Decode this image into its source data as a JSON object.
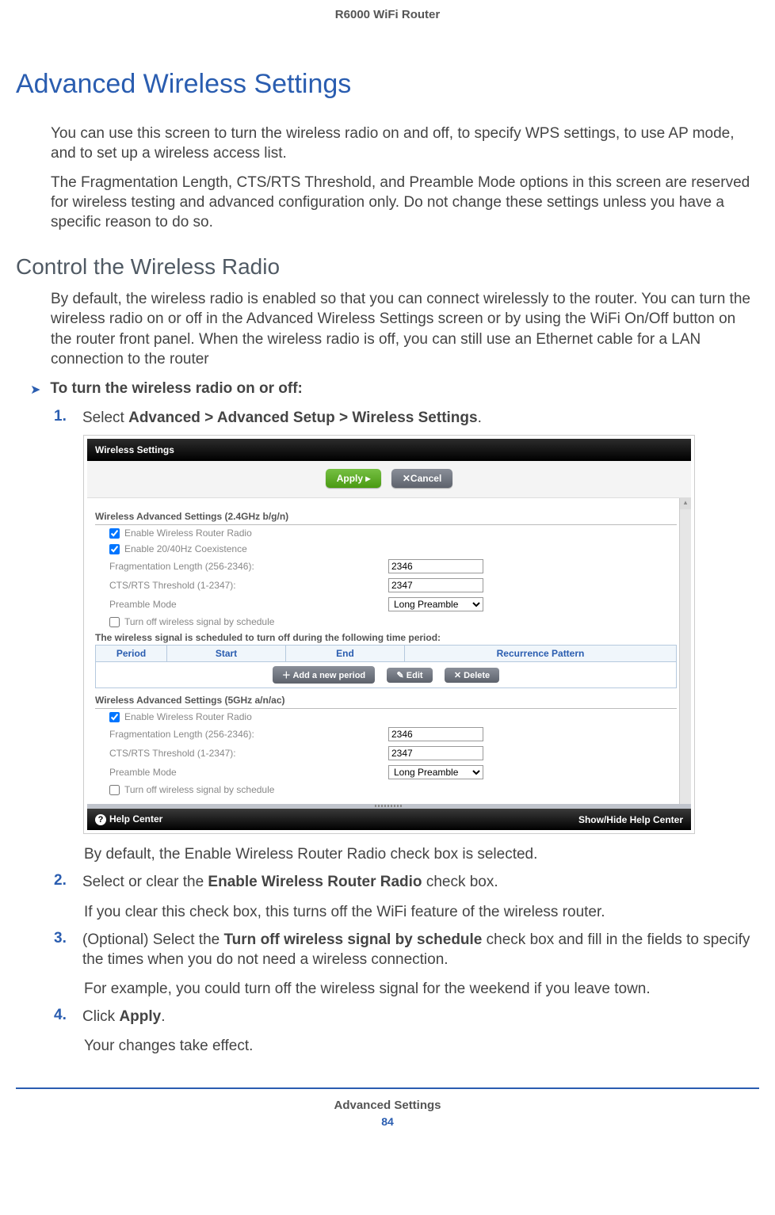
{
  "header": {
    "product": "R6000 WiFi Router"
  },
  "h1": "Advanced Wireless Settings",
  "intro": [
    "You can use this screen to turn the wireless radio on and off, to specify WPS settings, to use AP mode, and to set up a wireless access list.",
    "The Fragmentation Length, CTS/RTS Threshold, and Preamble Mode options in this screen are reserved for wireless testing and advanced configuration only. Do not change these settings unless you have a specific reason to do so."
  ],
  "h2": "Control the Wireless Radio",
  "section_intro": "By default, the wireless radio is enabled so that you can connect wirelessly to the router. You can turn the wireless radio on or off in the Advanced Wireless Settings screen or by using the WiFi On/Off button on the router front panel. When the wireless radio is off, you can still use an Ethernet cable for a LAN connection to the router",
  "procedure": {
    "title": "To turn the wireless radio on or off:",
    "steps": [
      {
        "num": "1.",
        "parts": [
          {
            "text": "Select ",
            "bold": false
          },
          {
            "text": "Advanced > Advanced Setup > Wireless Settings",
            "bold": true
          },
          {
            "text": ".",
            "bold": false
          }
        ],
        "followups": [
          "By default, the Enable Wireless Router Radio check box is selected."
        ],
        "has_screenshot": true
      },
      {
        "num": "2.",
        "parts": [
          {
            "text": "Select or clear the ",
            "bold": false
          },
          {
            "text": "Enable Wireless Router Radio",
            "bold": true
          },
          {
            "text": " check box.",
            "bold": false
          }
        ],
        "followups": [
          "If you clear this check box, this turns off the WiFi feature of the wireless router."
        ]
      },
      {
        "num": "3.",
        "parts": [
          {
            "text": "(Optional) Select the ",
            "bold": false
          },
          {
            "text": "Turn off wireless signal by schedule",
            "bold": true
          },
          {
            "text": " check box and fill in the fields to specify the times when you do not need a wireless connection.",
            "bold": false
          }
        ],
        "followups": [
          "For example, you could turn off the wireless signal for the weekend if you leave town."
        ]
      },
      {
        "num": "4.",
        "parts": [
          {
            "text": "Click ",
            "bold": false
          },
          {
            "text": "Apply",
            "bold": true
          },
          {
            "text": ".",
            "bold": false
          }
        ],
        "followups": [
          "Your changes take effect."
        ]
      }
    ]
  },
  "screenshot": {
    "title": "Wireless Settings",
    "buttons": {
      "apply": "Apply ▸",
      "cancel": "✕Cancel"
    },
    "scroll_arrow": "▴",
    "band24": {
      "heading": "Wireless Advanced Settings (2.4GHz b/g/n)",
      "enable_radio": "Enable Wireless Router Radio",
      "enable_2040": "Enable 20/40Hz Coexistence",
      "frag_label": "Fragmentation Length (256-2346):",
      "frag_value": "2346",
      "cts_label": "CTS/RTS Threshold (1-2347):",
      "cts_value": "2347",
      "preamble_label": "Preamble Mode",
      "preamble_value": "Long Preamble",
      "turnoff_label": "Turn off wireless signal by schedule",
      "sched_note": "The wireless signal is scheduled to turn off during the following time period:",
      "tbl": {
        "period": "Period",
        "start": "Start",
        "end": "End",
        "rec": "Recurrence Pattern"
      },
      "tbl_btns": {
        "add": "＋ Add a new period",
        "edit": "✎ Edit",
        "del": "✕ Delete"
      }
    },
    "band5": {
      "heading": "Wireless Advanced Settings (5GHz a/n/ac)",
      "enable_radio": "Enable Wireless Router Radio",
      "frag_label": "Fragmentation Length (256-2346):",
      "frag_value": "2346",
      "cts_label": "CTS/RTS Threshold (1-2347):",
      "cts_value": "2347",
      "preamble_label": "Preamble Mode",
      "preamble_value": "Long Preamble",
      "turnoff_label": "Turn off wireless signal by schedule"
    },
    "footer": {
      "help": "Help Center",
      "showhide": "Show/Hide Help Center"
    }
  },
  "footer": {
    "section": "Advanced Settings",
    "page": "84"
  }
}
